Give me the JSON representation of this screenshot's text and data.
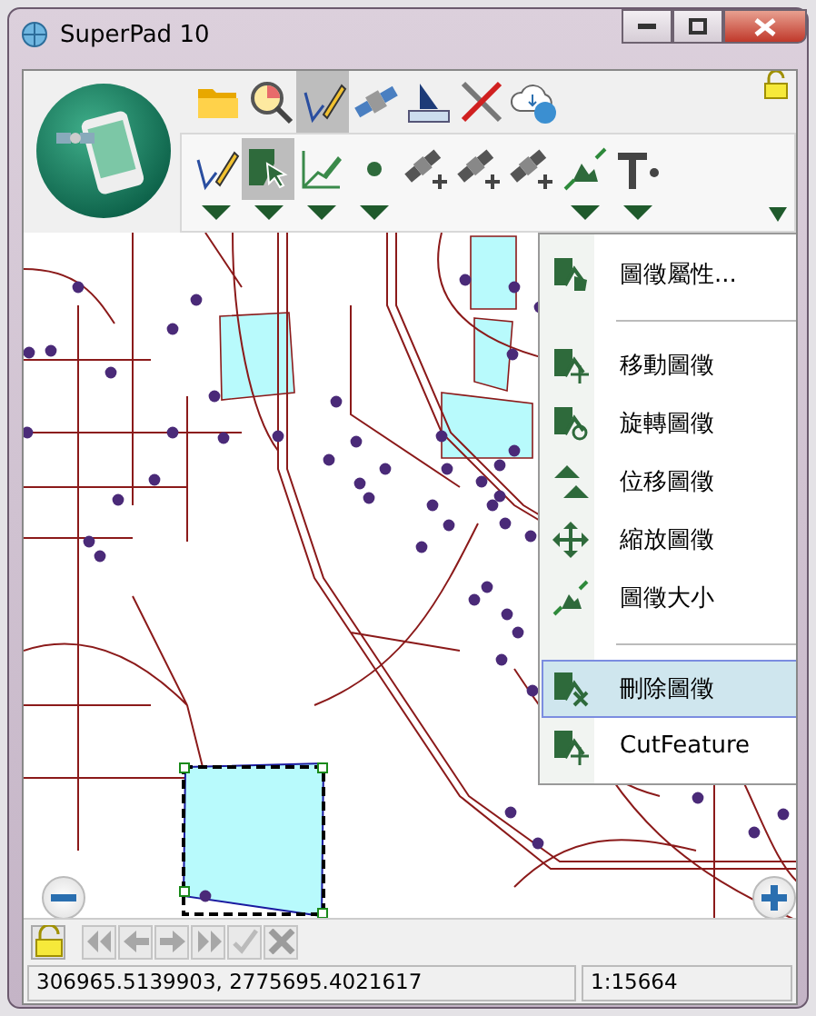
{
  "window": {
    "title": "SuperPad 10"
  },
  "main_tools": [
    {
      "kind": "folder",
      "selected": false
    },
    {
      "kind": "magnifier",
      "selected": false
    },
    {
      "kind": "pencil",
      "selected": true
    },
    {
      "kind": "satellite",
      "selected": false
    },
    {
      "kind": "ruler",
      "selected": false
    },
    {
      "kind": "tools",
      "selected": false
    },
    {
      "kind": "cloud",
      "selected": false
    }
  ],
  "edit_tools": [
    {
      "kind": "pencil",
      "selected": false,
      "has_dropdown": true
    },
    {
      "kind": "select",
      "selected": true,
      "has_dropdown": true
    },
    {
      "kind": "line",
      "selected": false,
      "has_dropdown": true
    },
    {
      "kind": "point",
      "selected": false,
      "has_dropdown": true
    },
    {
      "kind": "gps",
      "selected": false,
      "has_dropdown": false
    },
    {
      "kind": "gps",
      "selected": false,
      "has_dropdown": false
    },
    {
      "kind": "gps",
      "selected": false,
      "has_dropdown": false
    },
    {
      "kind": "resize",
      "selected": false,
      "has_dropdown": true
    },
    {
      "kind": "text",
      "selected": false,
      "has_dropdown": true
    }
  ],
  "context_menu": {
    "items": [
      {
        "kind": "properties",
        "label": "圖徵屬性...",
        "selected": false
      },
      {
        "kind": "separator"
      },
      {
        "kind": "move",
        "label": "移動圖徵",
        "selected": false
      },
      {
        "kind": "rotate",
        "label": "旋轉圖徵",
        "selected": false
      },
      {
        "kind": "offset",
        "label": "位移圖徵",
        "selected": false
      },
      {
        "kind": "scale",
        "label": "縮放圖徵",
        "selected": false
      },
      {
        "kind": "resize",
        "label": "圖徵大小",
        "selected": false
      },
      {
        "kind": "separator"
      },
      {
        "kind": "delete",
        "label": "刪除圖徵",
        "selected": true
      },
      {
        "kind": "move",
        "label": "CutFeature",
        "selected": false
      }
    ]
  },
  "nav_buttons": [
    {
      "kind": "first",
      "disabled": true
    },
    {
      "kind": "prev",
      "disabled": true
    },
    {
      "kind": "next",
      "disabled": true
    },
    {
      "kind": "last",
      "disabled": true
    },
    {
      "kind": "check",
      "disabled": true
    },
    {
      "kind": "cancel",
      "disabled": true
    }
  ],
  "status_bar": {
    "coordinates": "306965.5139903, 2775695.4021617",
    "scale": "1:15664"
  }
}
